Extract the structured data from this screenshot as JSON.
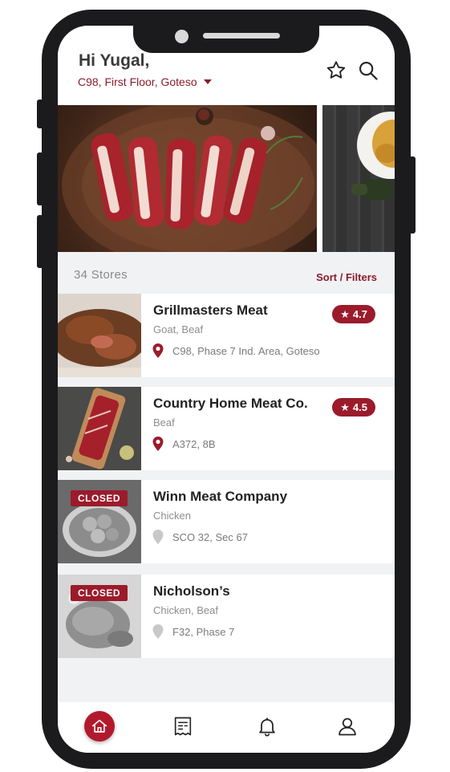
{
  "header": {
    "greeting": "Hi Yugal,",
    "address": "C98, First Floor, Goteso",
    "icons": [
      "star-icon",
      "search-icon"
    ]
  },
  "list": {
    "store_count": "34 Stores",
    "sort_label": "Sort / Filters"
  },
  "stores": [
    {
      "name": "Grillmasters Meat",
      "category": "Goat, Beaf",
      "location": "C98, Phase 7 Ind. Area, Goteso",
      "rating": "4.7",
      "status": "open"
    },
    {
      "name": "Country Home Meat Co.",
      "category": "Beaf",
      "location": "A372, 8B",
      "rating": "4.5",
      "status": "open"
    },
    {
      "name": "Winn Meat Company",
      "category": "Chicken",
      "location": "SCO 32, Sec 67",
      "status": "closed",
      "status_label": "CLOSED"
    },
    {
      "name": "Nicholson’s",
      "category": "Chicken, Beaf",
      "location": "F32, Phase 7",
      "status": "closed",
      "status_label": "CLOSED"
    }
  ],
  "tabs": [
    {
      "icon": "home-icon",
      "active": true
    },
    {
      "icon": "receipt-icon",
      "active": false
    },
    {
      "icon": "bell-icon",
      "active": false
    },
    {
      "icon": "user-icon",
      "active": false
    }
  ],
  "colors": {
    "accent": "#9b1b2b",
    "text_dark": "#222222",
    "muted": "#8d8d8d",
    "background": "#f1f2f4"
  }
}
